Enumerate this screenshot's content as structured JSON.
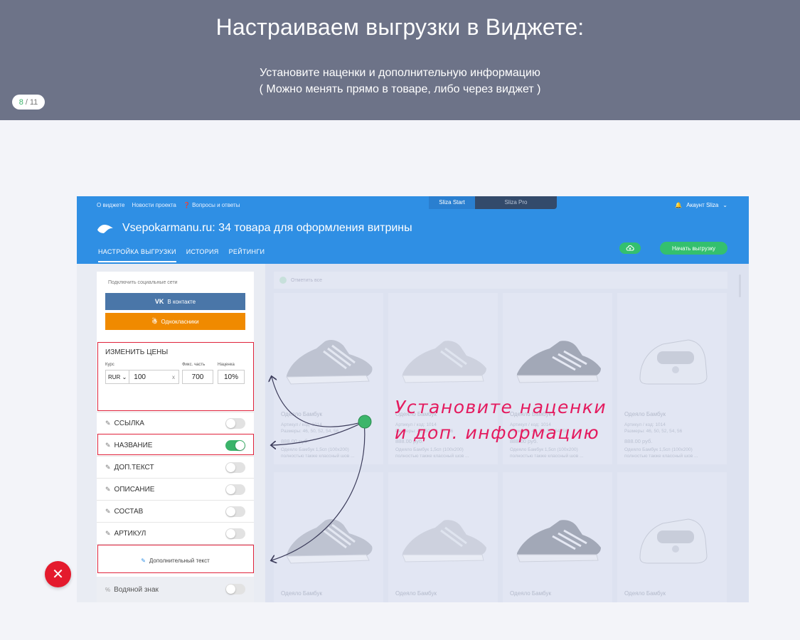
{
  "banner": {
    "title": "Настраиваем выгрузки в Виджете:",
    "subtitle_line1": "Установите наценки и дополнительную информацию",
    "subtitle_line2": "( Можно менять прямо в товаре, либо через виджет )",
    "page_current": "8",
    "page_sep": "/",
    "page_total": "11"
  },
  "app": {
    "top_links": [
      "О виджете",
      "Новости проекта",
      "Вопросы и ответы"
    ],
    "plan_start": "Sliza Start",
    "plan_pro": "Sliza Pro",
    "account": "Акаунт Sliza",
    "store_title": "Vsepokarmanu.ru: 34 товара для оформления витрины",
    "tabs": [
      "НАСТРОЙКА ВЫГРУЗКИ",
      "ИСТОРИЯ",
      "РЕЙТИНГИ"
    ],
    "start_button": "Начать выгрузку",
    "accent": "#2f8fe4",
    "green": "#34c06e"
  },
  "panel": {
    "social_label": "Подключить социальные сети",
    "vk_label": "В контакте",
    "ok_label": "Однокласники",
    "price_title": "ИЗМЕНИТЬ ЦЕНЫ",
    "course_label": "Курс",
    "fix_label": "Фикс. часть",
    "markup_label": "Наценка",
    "currency": "RUR",
    "course_value": "100",
    "x_label": "x",
    "fix_value": "700",
    "markup_value": "10%",
    "settings": [
      {
        "label": "ССЫЛКА",
        "on": false
      },
      {
        "label": "НАЗВАНИЕ",
        "on": true
      },
      {
        "label": "ДОП.ТЕКСТ",
        "on": false
      },
      {
        "label": "ОПИСАНИЕ",
        "on": false
      },
      {
        "label": "СОСТАВ",
        "on": false
      },
      {
        "label": "АРТИКУЛ",
        "on": false
      }
    ],
    "add_text": "Дополнительный текст",
    "watermark": "Водяной знак"
  },
  "grid": {
    "select_all": "Отметить все",
    "cards": [
      {
        "title": "Одеяло Бамбук",
        "line1": "Артикул / код: 1014",
        "line2": "Размеры: 46, 50, 52, 54, 56",
        "price": "888.00 руб.",
        "desc1": "Одеяло Бамбук 1,5сп (100х200)",
        "desc2": "полностью также классный шов ..."
      },
      {
        "title": "Одеяло Бамбук",
        "line1": "Артикул / код: 1014",
        "line2": "Размеры: 46, 50, 52, 54, 56",
        "price": "888.00 руб.",
        "desc1": "Одеяло Бамбук 1,5сп (100х200)",
        "desc2": "полностью также классный шов ..."
      },
      {
        "title": "Одеяло Бамбук",
        "line1": "Артикул / код: 1014",
        "line2": "Размеры: 46, 50, 52, 54, 56",
        "price": "888.00 руб.",
        "desc1": "Одеяло Бамбук 1,5сп (100х200)",
        "desc2": "полностью также классный шов ..."
      },
      {
        "title": "Одеяло Бамбук",
        "line1": "Артикул / код: 1014",
        "line2": "Размеры: 46, 50, 52, 54, 56",
        "price": "888.00 руб.",
        "desc1": "Одеяло Бамбук 1,5сп (100х200)",
        "desc2": "полностью также классный шов ..."
      },
      {
        "title": "Одеяло Бамбук"
      },
      {
        "title": "Одеяло Бамбук"
      },
      {
        "title": "Одеяло Бамбук"
      },
      {
        "title": "Одеяло Бамбук"
      }
    ]
  },
  "annotation": {
    "line1": "Установите наценки",
    "line2": "и доп. информацию",
    "color": "#e41a5e"
  },
  "icons": [
    "bell-icon",
    "chevron-down-icon",
    "question-icon",
    "bird-logo-icon",
    "cloud-upload-icon",
    "vk-icon",
    "ok-icon",
    "pencil-icon",
    "close-icon",
    "sneaker-image"
  ]
}
